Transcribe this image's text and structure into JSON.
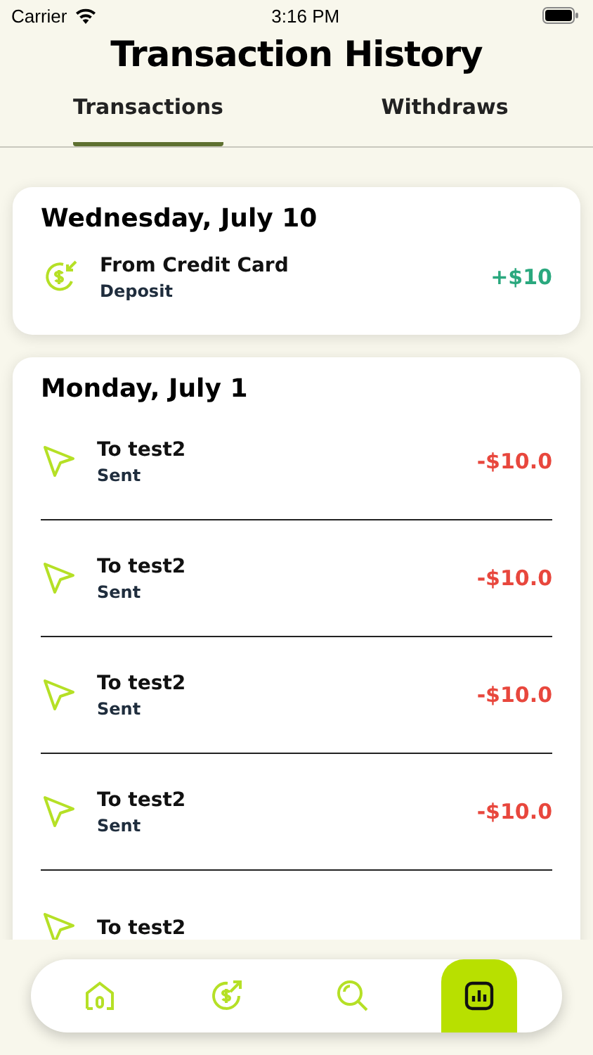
{
  "status_bar": {
    "carrier": "Carrier",
    "time": "3:16 PM"
  },
  "title": "Transaction History",
  "tabs": [
    {
      "label": "Transactions",
      "selected": true
    },
    {
      "label": "Withdraws",
      "selected": false
    }
  ],
  "groups": [
    {
      "date": "Wednesday, July 10",
      "transactions": [
        {
          "kind": "deposit",
          "title": "From Credit Card",
          "subtitle": "Deposit",
          "amount": "+$10"
        }
      ]
    },
    {
      "date": "Monday, July 1",
      "transactions": [
        {
          "kind": "sent",
          "title": "To test2",
          "subtitle": "Sent",
          "amount": "-$10.0"
        },
        {
          "kind": "sent",
          "title": "To test2",
          "subtitle": "Sent",
          "amount": "-$10.0"
        },
        {
          "kind": "sent",
          "title": "To test2",
          "subtitle": "Sent",
          "amount": "-$10.0"
        },
        {
          "kind": "sent",
          "title": "To test2",
          "subtitle": "Sent",
          "amount": "-$10.0"
        },
        {
          "kind": "sent",
          "title": "To test2"
        }
      ]
    }
  ],
  "nav": [
    {
      "kind": "home",
      "selected": false
    },
    {
      "kind": "send",
      "selected": false
    },
    {
      "kind": "search",
      "selected": false
    },
    {
      "kind": "stats",
      "selected": true
    }
  ]
}
